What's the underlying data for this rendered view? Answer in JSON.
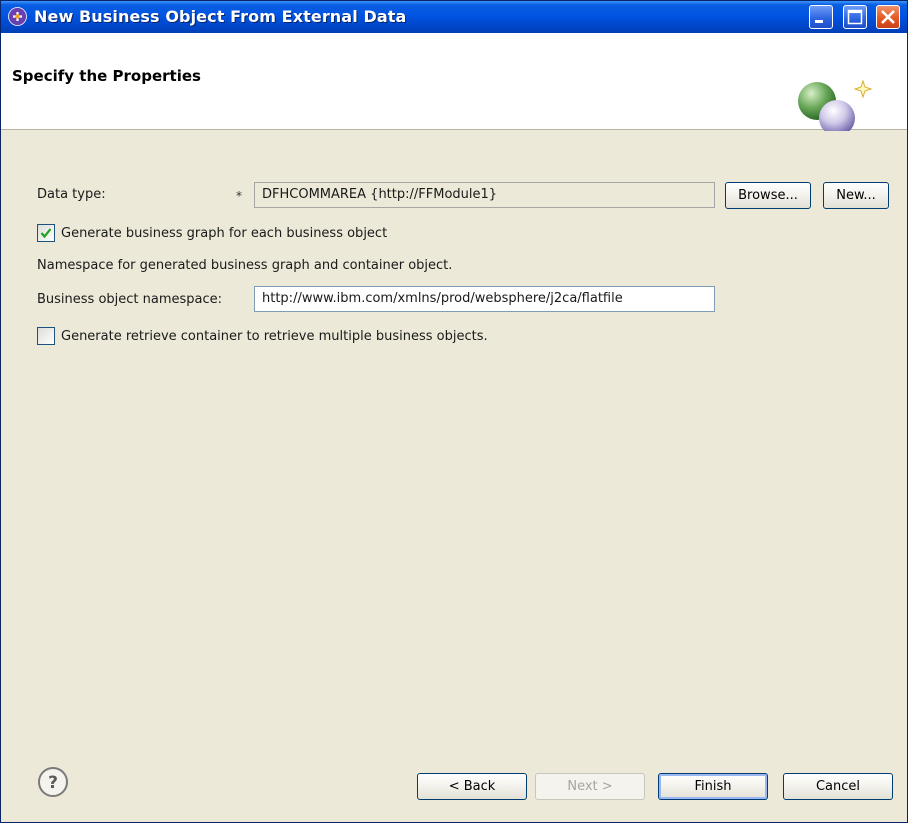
{
  "window": {
    "title": "New Business Object From External Data"
  },
  "banner": {
    "title": "Specify the Properties",
    "graphic_icon": "wizard-spheres-icon"
  },
  "form": {
    "data_type_label": "Data type:",
    "required_marker": "*",
    "data_type_value": "DFHCOMMAREA  {http://FFModule1}",
    "browse_button": "Browse...",
    "new_button": "New...",
    "generate_bg_checkbox": {
      "label": "Generate business graph for each business object",
      "checked": true
    },
    "namespace_info": "Namespace for generated business graph and container object.",
    "bo_namespace_label": "Business object namespace:",
    "bo_namespace_value": "http://www.ibm.com/xmlns/prod/websphere/j2ca/flatfile",
    "retrieve_container_checkbox": {
      "label": "Generate retrieve container to retrieve multiple business objects.",
      "checked": false
    }
  },
  "footer": {
    "help_icon": "help-icon",
    "back_button": "< Back",
    "next_button": "Next >",
    "finish_button": "Finish",
    "cancel_button": "Cancel"
  },
  "colors": {
    "titlebar": "#0054e3",
    "dialog_bg": "#ece9d8",
    "banner_bg": "#ffffff",
    "check_mark": "#21a121"
  }
}
